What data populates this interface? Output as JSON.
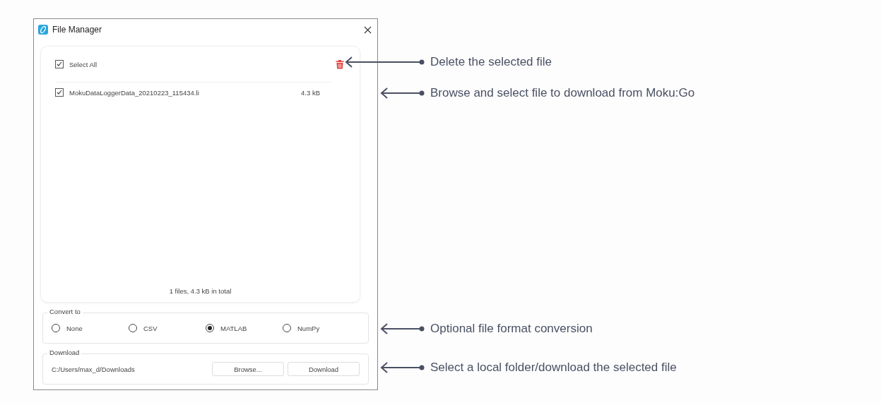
{
  "window": {
    "title": "File Manager"
  },
  "file_list": {
    "select_all": {
      "label": "Select All",
      "checked": true
    },
    "files": [
      {
        "name": "MokuDataLoggerData_20210223_115434.li",
        "size": "4.3 kB",
        "checked": true
      }
    ],
    "summary": "1 files, 4.3 kB in total"
  },
  "convert": {
    "legend": "Convert to",
    "options": [
      {
        "label": "None",
        "selected": false
      },
      {
        "label": "CSV",
        "selected": false
      },
      {
        "label": "MATLAB",
        "selected": true
      },
      {
        "label": "NumPy",
        "selected": false
      }
    ]
  },
  "download": {
    "legend": "Download",
    "path": "C:/Users/max_d/Downloads",
    "buttons": [
      "Browse...",
      "Download"
    ]
  },
  "annotations": [
    {
      "kind": "long",
      "text": "Delete the selected file"
    },
    {
      "kind": "short",
      "text": "Browse and select file to download from Moku:Go"
    },
    {
      "kind": "short",
      "text": "Optional file format conversion"
    },
    {
      "kind": "short",
      "text": "Select a local folder/download the selected file"
    }
  ]
}
